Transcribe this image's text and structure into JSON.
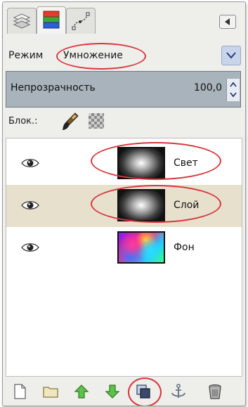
{
  "panel": {
    "tabs": [
      {
        "icon": "layers-tab-icon",
        "active": false
      },
      {
        "icon": "channels-tab-icon",
        "active": true
      },
      {
        "icon": "paths-tab-icon",
        "active": false
      }
    ],
    "menu_icon": "dock-menu-icon"
  },
  "mode": {
    "label": "Режим",
    "value": "Умножение"
  },
  "opacity": {
    "label": "Непрозрачность",
    "value": "100,0"
  },
  "lock": {
    "label": "Блок.:"
  },
  "layers": [
    {
      "name": "Свет",
      "thumbnail": "radial-glow",
      "visible": true,
      "selected": false
    },
    {
      "name": "Слой",
      "thumbnail": "radial-glow",
      "visible": true,
      "selected": true
    },
    {
      "name": "Фон",
      "thumbnail": "colorful-swirl",
      "visible": true,
      "selected": false
    }
  ],
  "toolbar": {
    "buttons": [
      "new-layer-icon",
      "layer-group-icon",
      "raise-layer-icon",
      "lower-layer-icon",
      "duplicate-layer-icon",
      "anchor-layer-icon",
      "delete-layer-icon"
    ]
  },
  "colors": {
    "annotation_ring": "#d9363e",
    "selected_row": "#e6e0cd",
    "opacity_bar": "#a8b3bc"
  }
}
